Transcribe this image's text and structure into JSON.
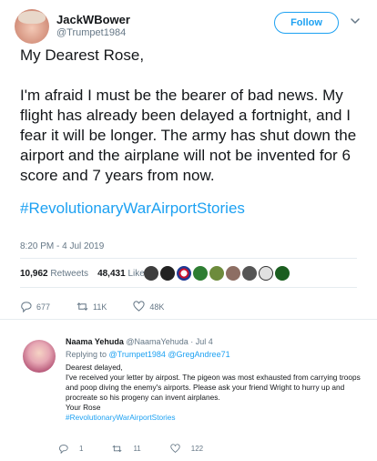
{
  "main_tweet": {
    "display_name": "JackWBower",
    "handle": "@Trumpet1984",
    "follow_label": "Follow",
    "paragraphs": [
      "My Dearest Rose,",
      "I'm afraid I must be the bearer of bad news. My flight has already been delayed a fortnight, and I fear it will be longer. The army has shut down the airport and the airplane will not be invented for 6 score and 7 years from now."
    ],
    "hashtag": "#RevolutionaryWarAirportStories",
    "timestamp": "8:20 PM - 4 Jul 2019",
    "stats": {
      "retweets_count": "10,962",
      "retweets_label": "Retweets",
      "likes_count": "48,431",
      "likes_label": "Likes"
    },
    "actions": {
      "replies": "677",
      "retweets": "11K",
      "likes": "48K"
    },
    "icons": [
      "chevron-down-icon",
      "reply-icon",
      "retweet-icon",
      "heart-icon"
    ]
  },
  "reply_tweet": {
    "display_name": "Naama Yehuda",
    "handle": "@NaamaYehuda",
    "date": "· Jul 4",
    "replying_to_label": "Replying to",
    "replying_to_users": [
      "@Trumpet1984",
      "@GregAndree71"
    ],
    "body_lines": [
      "Dearest delayed,",
      "I've received your letter by airpost. The pigeon was most exhausted from carrying troops and poop diving the enemy's airports. Please ask your friend Wright to hurry up and procreate so his progeny can invent airplanes.",
      "Your Rose"
    ],
    "hashtag": "#RevolutionaryWarAirportStories",
    "actions": {
      "replies": "1",
      "retweets": "11",
      "likes": "122"
    }
  },
  "colors": {
    "accent": "#1da1f2",
    "muted": "#657786",
    "text": "#14171a",
    "divider": "#e6ecf0"
  }
}
